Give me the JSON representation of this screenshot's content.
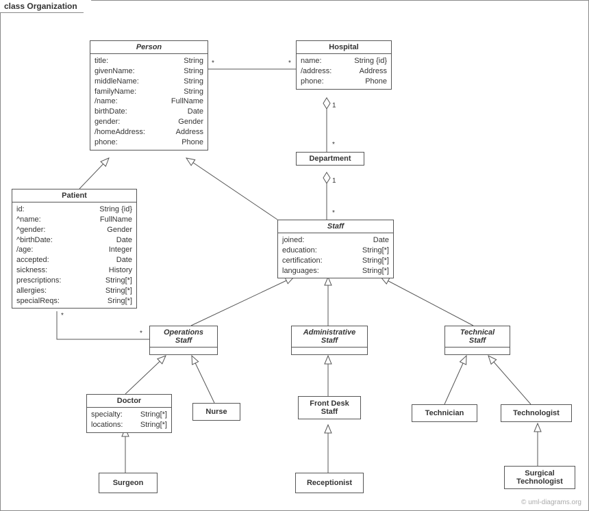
{
  "diagram": {
    "title": "class Organization",
    "watermark": "© uml-diagrams.org"
  },
  "classes": {
    "person": {
      "name": "Person",
      "abstract": true,
      "attrs": [
        {
          "name": "title:",
          "type": "String"
        },
        {
          "name": "givenName:",
          "type": "String"
        },
        {
          "name": "middleName:",
          "type": "String"
        },
        {
          "name": "familyName:",
          "type": "String"
        },
        {
          "name": "/name:",
          "type": "FullName"
        },
        {
          "name": "birthDate:",
          "type": "Date"
        },
        {
          "name": "gender:",
          "type": "Gender"
        },
        {
          "name": "/homeAddress:",
          "type": "Address"
        },
        {
          "name": "phone:",
          "type": "Phone"
        }
      ]
    },
    "hospital": {
      "name": "Hospital",
      "abstract": false,
      "attrs": [
        {
          "name": "name:",
          "type": "String {id}"
        },
        {
          "name": "/address:",
          "type": "Address"
        },
        {
          "name": "phone:",
          "type": "Phone"
        }
      ]
    },
    "department": {
      "name": "Department",
      "abstract": false,
      "attrs": []
    },
    "patient": {
      "name": "Patient",
      "abstract": false,
      "attrs": [
        {
          "name": "id:",
          "type": "String {id}"
        },
        {
          "name": "^name:",
          "type": "FullName"
        },
        {
          "name": "^gender:",
          "type": "Gender"
        },
        {
          "name": "^birthDate:",
          "type": "Date"
        },
        {
          "name": "/age:",
          "type": "Integer"
        },
        {
          "name": "accepted:",
          "type": "Date"
        },
        {
          "name": "sickness:",
          "type": "History"
        },
        {
          "name": "prescriptions:",
          "type": "String[*]"
        },
        {
          "name": "allergies:",
          "type": "String[*]"
        },
        {
          "name": "specialReqs:",
          "type": "Sring[*]"
        }
      ]
    },
    "staff": {
      "name": "Staff",
      "abstract": true,
      "attrs": [
        {
          "name": "joined:",
          "type": "Date"
        },
        {
          "name": "education:",
          "type": "String[*]"
        },
        {
          "name": "certification:",
          "type": "String[*]"
        },
        {
          "name": "languages:",
          "type": "String[*]"
        }
      ]
    },
    "operationsstaff": {
      "name": "OperationsStaff",
      "abstract": true,
      "attrs": [],
      "twoline": [
        "Operations",
        "Staff"
      ]
    },
    "adminstaff": {
      "name": "AdministrativeStaff",
      "abstract": true,
      "attrs": [],
      "twoline": [
        "Administrative",
        "Staff"
      ]
    },
    "techstaff": {
      "name": "TechnicalStaff",
      "abstract": true,
      "attrs": [],
      "twoline": [
        "Technical",
        "Staff"
      ]
    },
    "doctor": {
      "name": "Doctor",
      "abstract": false,
      "attrs": [
        {
          "name": "specialty:",
          "type": "String[*]"
        },
        {
          "name": "locations:",
          "type": "String[*]"
        }
      ]
    },
    "nurse": {
      "name": "Nurse",
      "abstract": false,
      "attrs": []
    },
    "frontdeskstaff": {
      "name": "FrontDeskStaff",
      "abstract": false,
      "attrs": [],
      "twoline": [
        "Front Desk",
        "Staff"
      ]
    },
    "technician": {
      "name": "Technician",
      "abstract": false,
      "attrs": []
    },
    "technologist": {
      "name": "Technologist",
      "abstract": false,
      "attrs": []
    },
    "surgeon": {
      "name": "Surgeon",
      "abstract": false,
      "attrs": []
    },
    "receptionist": {
      "name": "Receptionist",
      "abstract": false,
      "attrs": []
    },
    "surgicaltechnologist": {
      "name": "SurgicalTechnologist",
      "abstract": false,
      "attrs": [],
      "twoline": [
        "Surgical",
        "Technologist"
      ]
    }
  },
  "multiplicities": {
    "person_hospital_person": "*",
    "person_hospital_hospital": "*",
    "hospital_department_hospital": "1",
    "hospital_department_department": "*",
    "department_staff_department": "1",
    "department_staff_staff": "*",
    "patient_opstaff_patient": "*",
    "patient_opstaff_opstaff": "*"
  }
}
